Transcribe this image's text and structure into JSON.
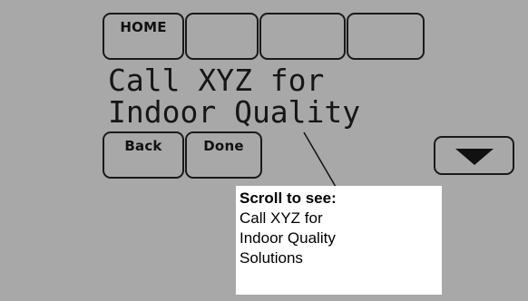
{
  "top_buttons": {
    "home_label": "HOME",
    "button2_label": "",
    "button3_label": "",
    "button4_label": ""
  },
  "display": {
    "line1": "Call XYZ for",
    "line2": "Indoor Quality"
  },
  "bottom_buttons": {
    "back_label": "Back",
    "done_label": "Done",
    "scroll_down_icon": "down-arrow-icon"
  },
  "callout": {
    "title": "Scroll to see:",
    "lines": [
      "Call XYZ for",
      "Indoor Quality",
      "Solutions"
    ]
  },
  "colors": {
    "screen_background": "#a8a8a8",
    "foreground": "#111111",
    "callout_background": "#ffffff"
  }
}
